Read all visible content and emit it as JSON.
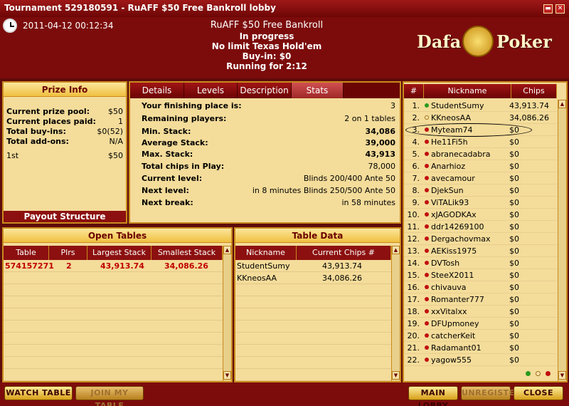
{
  "window": {
    "title": "Tournament 529180591 - RuAFF $50 Free Bankroll lobby"
  },
  "header": {
    "datetime": "2011-04-12 00:12:34",
    "tournament_name": "RuAFF $50 Free Bankroll",
    "status": "In progress",
    "game_type": "No limit Texas Hold'em",
    "buy_in": "Buy-in: $0",
    "running_for": "Running for 2:12",
    "logo": {
      "left": "Dafa",
      "right": "Poker"
    }
  },
  "prize_info": {
    "title": "Prize Info",
    "rows": [
      {
        "label": "Current prize pool:",
        "value": "$50"
      },
      {
        "label": "Current places paid:",
        "value": "1"
      },
      {
        "label": "Total buy-ins:",
        "value": "$0(52)"
      },
      {
        "label": "Total add-ons:",
        "value": "N/A"
      }
    ],
    "places": [
      {
        "place": "1st",
        "amount": "$50"
      }
    ],
    "payout_button": "Payout Structure"
  },
  "tabs": [
    "Details",
    "Levels",
    "Description",
    "Stats"
  ],
  "active_tab": "Stats",
  "stats": [
    {
      "label": "Your finishing place is:",
      "value": "3"
    },
    {
      "label": "Remaining players:",
      "value": "2 on 1 tables"
    },
    {
      "label": "Min. Stack:",
      "value": "34,086"
    },
    {
      "label": "Average Stack:",
      "value": "39,000"
    },
    {
      "label": "Max. Stack:",
      "value": "43,913"
    },
    {
      "label": "Total chips in Play:",
      "value": "78,000"
    },
    {
      "label": "Current level:",
      "value": "Blinds 200/400 Ante 50"
    },
    {
      "label": "Next level:",
      "value": "in 8 minutes Blinds 250/500 Ante 50"
    },
    {
      "label": "Next break:",
      "value": "in 58 minutes"
    }
  ],
  "open_tables": {
    "title": "Open Tables",
    "headers": [
      "Table",
      "Plrs",
      "Largest Stack",
      "Smallest Stack"
    ],
    "rows": [
      {
        "table": "574157271",
        "plrs": "2",
        "largest": "43,913.74",
        "smallest": "34,086.26"
      }
    ]
  },
  "table_data": {
    "title": "Table Data",
    "headers": [
      "Nickname",
      "Current Chips #"
    ],
    "rows": [
      {
        "nickname": "StudentSumy",
        "chips": "43,913.74"
      },
      {
        "nickname": "KKneosAA",
        "chips": "34,086.26"
      }
    ]
  },
  "players": {
    "headers": [
      "#",
      "Nickname",
      "Chips"
    ],
    "rows": [
      {
        "n": "1.",
        "name": "StudentSumy",
        "chips": "43,913.74",
        "status": "green"
      },
      {
        "n": "2.",
        "name": "KKneosAA",
        "chips": "34,086.26",
        "status": "open"
      },
      {
        "n": "3.",
        "name": "Myteam74",
        "chips": "$0",
        "status": "red"
      },
      {
        "n": "4.",
        "name": "He11Fi5h",
        "chips": "$0",
        "status": "red"
      },
      {
        "n": "5.",
        "name": "abranecadabra",
        "chips": "$0",
        "status": "red"
      },
      {
        "n": "6.",
        "name": "Anarhioz",
        "chips": "$0",
        "status": "red"
      },
      {
        "n": "7.",
        "name": "avecamour",
        "chips": "$0",
        "status": "red"
      },
      {
        "n": "8.",
        "name": "DjekSun",
        "chips": "$0",
        "status": "red"
      },
      {
        "n": "9.",
        "name": "ViTALik93",
        "chips": "$0",
        "status": "red"
      },
      {
        "n": "10.",
        "name": "xJAGODKAx",
        "chips": "$0",
        "status": "red"
      },
      {
        "n": "11.",
        "name": "ddr14269100",
        "chips": "$0",
        "status": "red"
      },
      {
        "n": "12.",
        "name": "Dergachovmax",
        "chips": "$0",
        "status": "red"
      },
      {
        "n": "13.",
        "name": "AEKiss1975",
        "chips": "$0",
        "status": "red"
      },
      {
        "n": "14.",
        "name": "DVTosh",
        "chips": "$0",
        "status": "red"
      },
      {
        "n": "15.",
        "name": "SteeX2011",
        "chips": "$0",
        "status": "red"
      },
      {
        "n": "16.",
        "name": "chivauva",
        "chips": "$0",
        "status": "red"
      },
      {
        "n": "17.",
        "name": "Romanter777",
        "chips": "$0",
        "status": "red"
      },
      {
        "n": "18.",
        "name": "xxVitalxx",
        "chips": "$0",
        "status": "red"
      },
      {
        "n": "19.",
        "name": "DFUpmoney",
        "chips": "$0",
        "status": "red"
      },
      {
        "n": "20.",
        "name": "catcherKeit",
        "chips": "$0",
        "status": "red"
      },
      {
        "n": "21.",
        "name": "Radamant01",
        "chips": "$0",
        "status": "red"
      },
      {
        "n": "22.",
        "name": "yagow555",
        "chips": "$0",
        "status": "red"
      }
    ]
  },
  "buttons": {
    "watch_table": "WATCH TABLE",
    "join_my_table": "JOIN MY TABLE",
    "main_lobby": "MAIN LOBBY",
    "unregister": "UNREGISTER",
    "close": "CLOSE"
  }
}
